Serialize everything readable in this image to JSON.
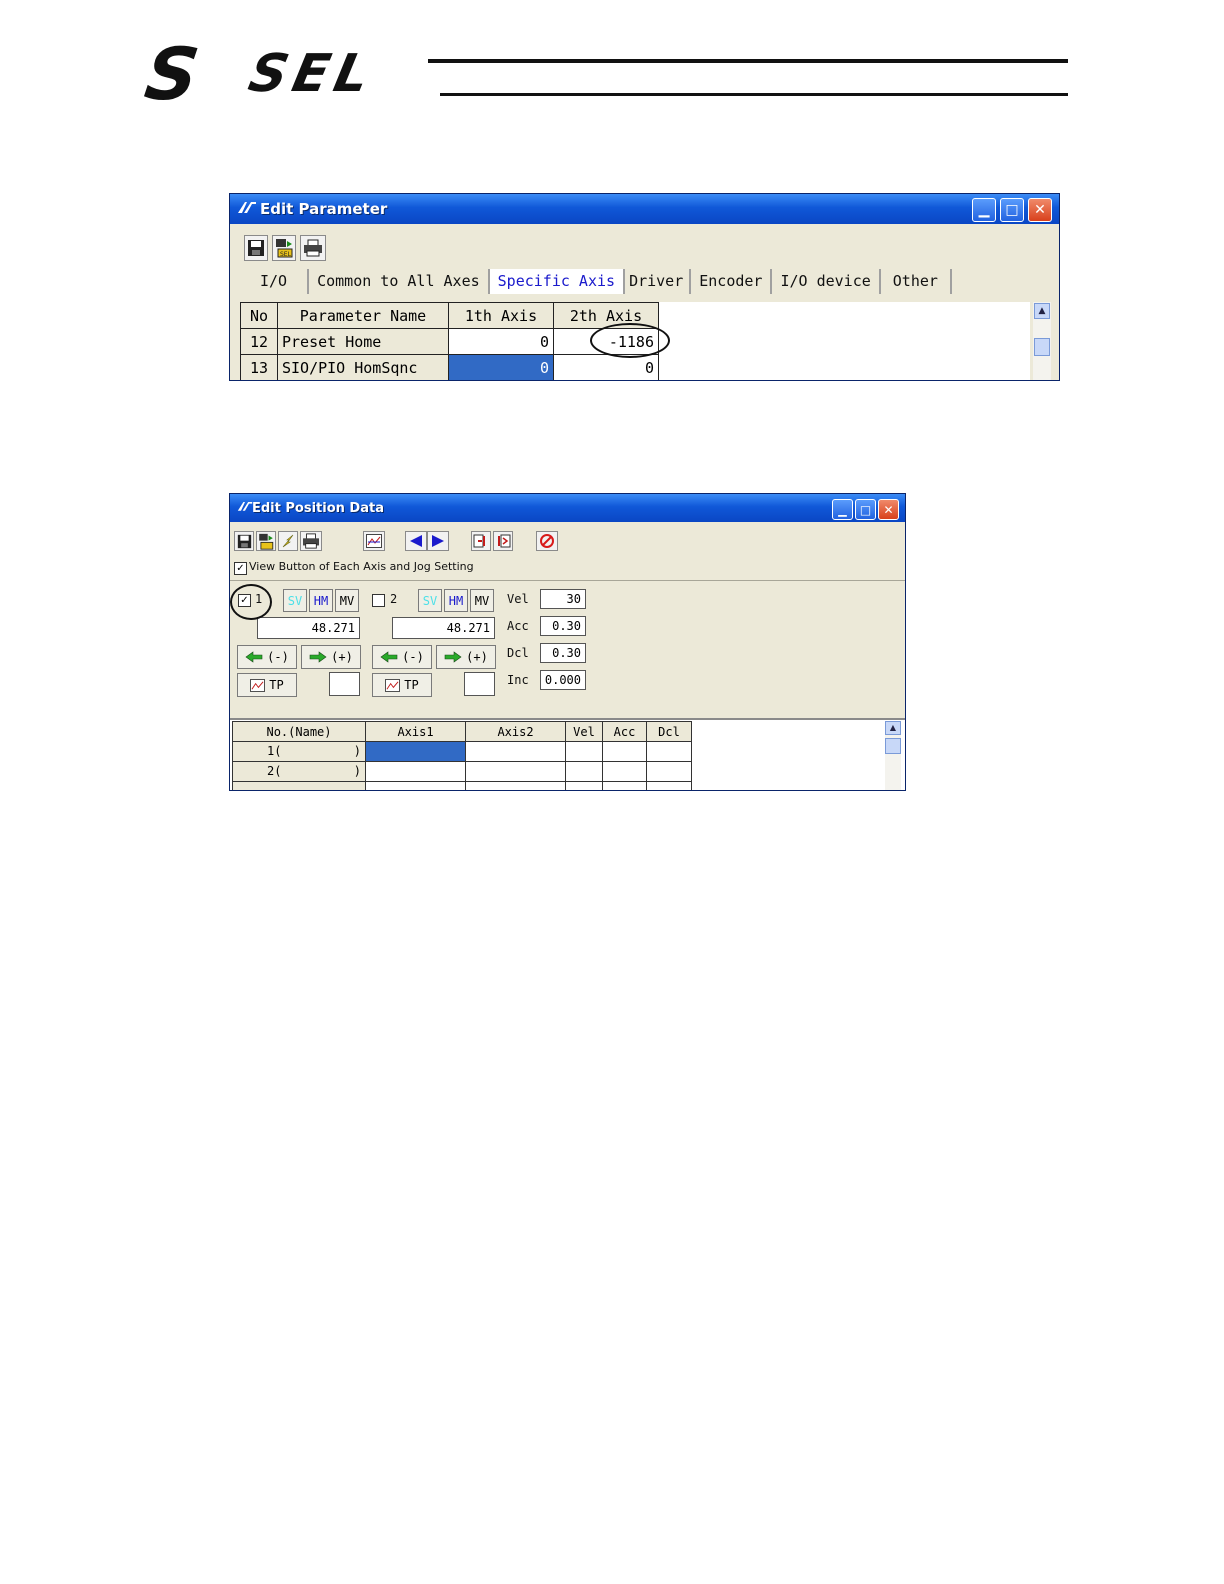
{
  "header": {
    "logo_text_s": "S",
    "logo_text_sel": "SEL"
  },
  "edit_parameter": {
    "title": "Edit Parameter",
    "toolbar": [
      "save-icon",
      "sel-transfer-icon",
      "print-icon"
    ],
    "tabs": [
      "I/O",
      "Common to All Axes",
      "Specific Axis",
      "Driver",
      "Encoder",
      "I/O device",
      "Other"
    ],
    "active_tab": "Specific Axis",
    "columns": [
      "No",
      "Parameter Name",
      "1th Axis",
      "2th Axis"
    ],
    "rows": [
      {
        "no": "12",
        "name": "Preset Home",
        "axis1": "0",
        "axis2": "-1186"
      },
      {
        "no": "13",
        "name": "SIO/PIO HomSqnc",
        "axis1": "0",
        "axis2": "0"
      }
    ]
  },
  "edit_position": {
    "title": "Edit Position Data",
    "view_check_label": "View Button of Each Axis and Jog Setting",
    "axis1": {
      "num": "1",
      "checked": "✓",
      "value": "48.271",
      "sv": "SV",
      "hm": "HM",
      "mv": "MV",
      "minus": "(-)",
      "plus": "(+)",
      "tp": "TP"
    },
    "axis2": {
      "num": "2",
      "checked": "",
      "value": "48.271",
      "sv": "SV",
      "hm": "HM",
      "mv": "MV",
      "minus": "(-)",
      "plus": "(+)",
      "tp": "TP"
    },
    "params": [
      {
        "label": "Vel",
        "value": "30"
      },
      {
        "label": "Acc",
        "value": "0.30"
      },
      {
        "label": "Dcl",
        "value": "0.30"
      },
      {
        "label": "Inc",
        "value": "0.000"
      }
    ],
    "columns": [
      "No.(Name)",
      "Axis1",
      "Axis2",
      "Vel",
      "Acc",
      "Dcl"
    ],
    "rows": [
      {
        "no": "1(",
        "close": ")"
      },
      {
        "no": "2(",
        "close": ")"
      }
    ]
  }
}
